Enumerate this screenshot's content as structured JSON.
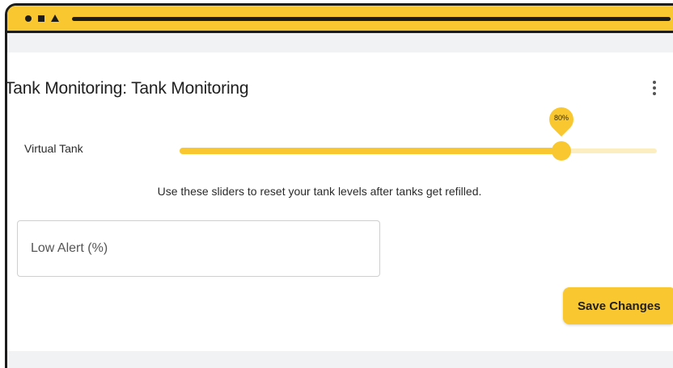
{
  "colors": {
    "accent": "#f9c830",
    "accent_light": "#fdeec2",
    "frame": "#1c1c1c",
    "strip": "#f1f2f4"
  },
  "window": {
    "icons": [
      "circle-icon",
      "square-icon",
      "triangle-icon"
    ]
  },
  "header": {
    "title": "Tank Monitoring: Tank Monitoring",
    "menu_icon": "kebab-menu-icon"
  },
  "tank_slider": {
    "label": "Virtual Tank",
    "value_percent": 80,
    "value_label": "80%"
  },
  "helper_text": "Use these sliders to reset your tank levels after tanks get refilled.",
  "low_alert": {
    "placeholder": "Low Alert (%)",
    "value": ""
  },
  "actions": {
    "save_label": "Save Changes"
  }
}
